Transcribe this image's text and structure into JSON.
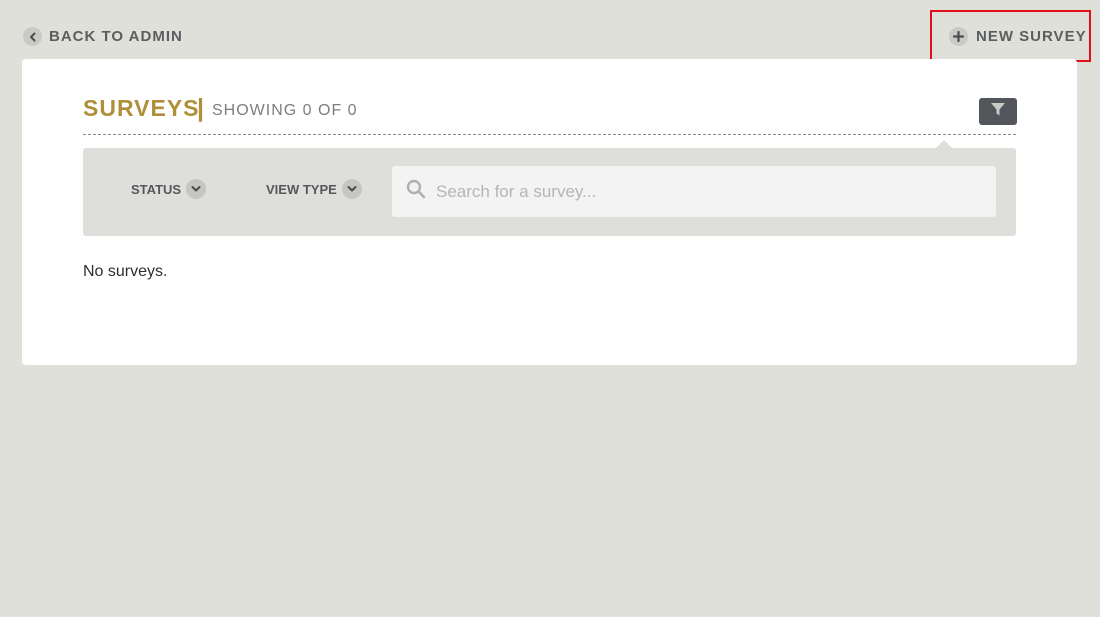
{
  "topbar": {
    "back_label": "BACK TO ADMIN",
    "back_icon": "chevron-left-icon",
    "new_survey_label": "NEW SURVEY",
    "new_survey_icon": "plus-icon"
  },
  "header": {
    "title": "SURVEYS",
    "divider": "|",
    "showing": "SHOWING 0 OF 0",
    "filter_icon": "filter-icon"
  },
  "filters": {
    "status_label": "STATUS",
    "view_type_label": "VIEW TYPE",
    "search_placeholder": "Search for a survey..."
  },
  "content": {
    "empty_message": "No surveys."
  },
  "colors": {
    "background": "#e0e0da",
    "accent_gold": "#b08f3a",
    "highlight_red": "#e0101a",
    "filter_button": "#52565a"
  }
}
